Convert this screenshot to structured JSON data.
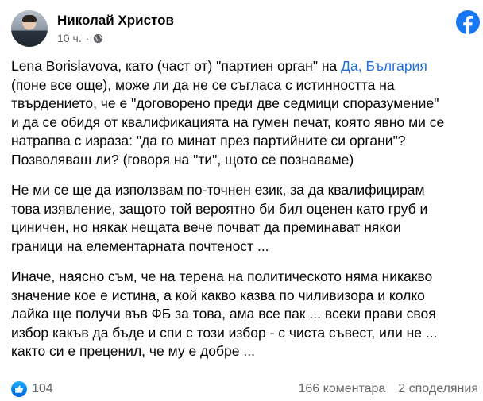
{
  "post": {
    "author": "Николай Христов",
    "time": "10 ч.",
    "dot": "·",
    "privacy_icon": "globe-icon",
    "brand_icon": "facebook-logo-icon",
    "brand_color": "#1877f2",
    "link_color": "#216fdb"
  },
  "body": {
    "p1_before_link": "Lena Borislavova, като (част от) \"партиен орган\" на ",
    "p1_link": "Да, България",
    "p1_after_link": "\n(поне все още), може ли да не се съгласа с истинността на\nтвърдението, че е \"договорено преди две седмици споразумение\"\nи да се обидя от квалификацията на гумен печат, която явно ми се\nнатрапва с израза: \"да го минат през партийните си органи\"?\nПозволяваш ли? (говоря на \"ти\", щото се познаваме)",
    "p2": "Не ми се ще да използвам по-точнен език, за да квалифицирам\nтова изявление, защото той вероятно би бил оценен като груб и\nциничен, но някак нещата вече почват да преминават някои\nграници на елементарната почтеност ...",
    "p3": "Иначе, наясно съм, че на терена на политическото няма никакво\nзначение кое е истина, а кой какво казва по чиливизора и колко\nлайка ще получи във ФБ за това, ама все пак ... всеки прави своя\nизбор какъв да бъде и спи с този избор - с чиста съвест, или не ...\nкакто си е преценил, че му е добре ..."
  },
  "footer": {
    "reaction_icon": "like-icon",
    "likes": "104",
    "comments": "166 коментара",
    "shares": "2 споделяния"
  }
}
